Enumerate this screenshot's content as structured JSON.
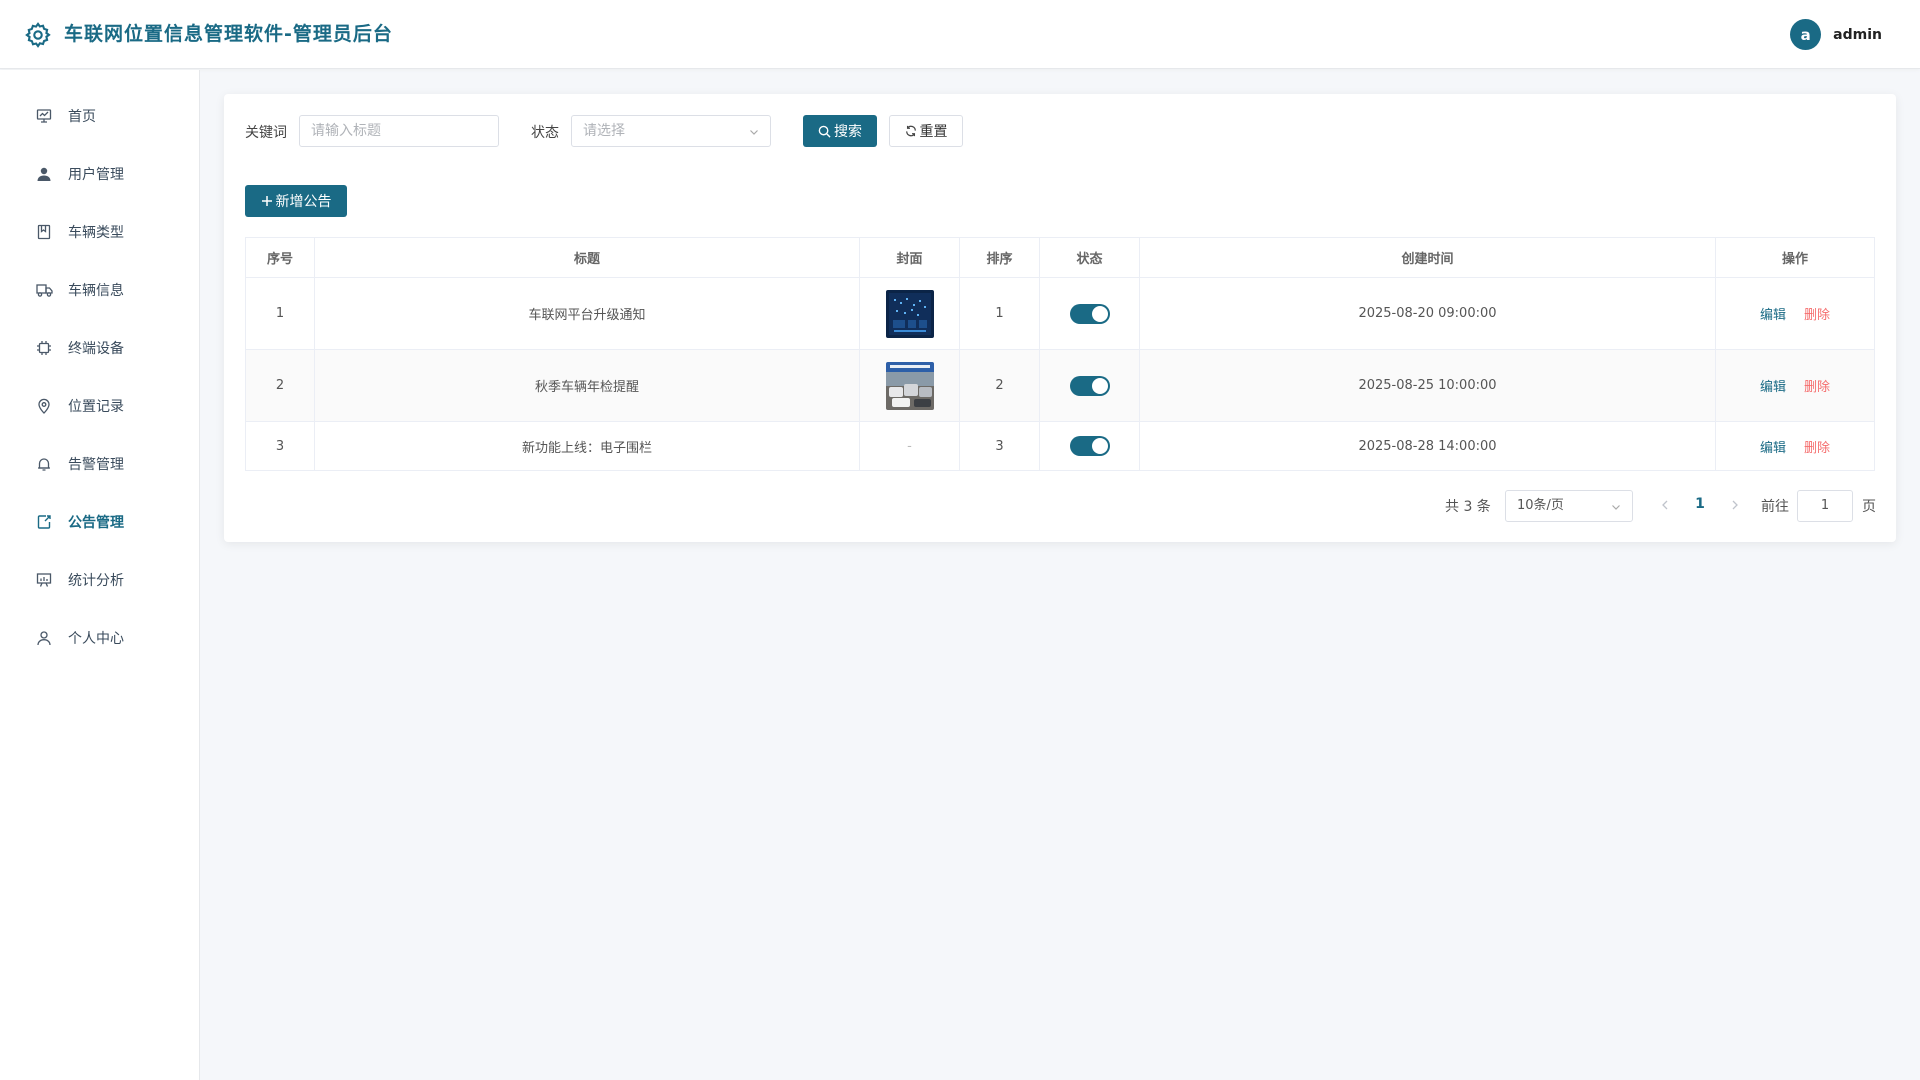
{
  "header": {
    "title": "车联网位置信息管理软件-管理员后台",
    "logo_icon": "gear-icon",
    "avatar_letter": "a",
    "username": "admin",
    "brand_color": "#1a6a85"
  },
  "sidebar": {
    "active_index": 7,
    "items": [
      {
        "label": "首页",
        "icon": "dashboard-icon"
      },
      {
        "label": "用户管理",
        "icon": "user-icon"
      },
      {
        "label": "车辆类型",
        "icon": "bookmark-icon"
      },
      {
        "label": "车辆信息",
        "icon": "truck-icon"
      },
      {
        "label": "终端设备",
        "icon": "chip-icon"
      },
      {
        "label": "位置记录",
        "icon": "location-pin-icon"
      },
      {
        "label": "告警管理",
        "icon": "bell-icon"
      },
      {
        "label": "公告管理",
        "icon": "notice-icon"
      },
      {
        "label": "统计分析",
        "icon": "chart-board-icon"
      },
      {
        "label": "个人中心",
        "icon": "person-outline-icon"
      }
    ]
  },
  "filters": {
    "keyword_label": "关键词",
    "keyword_placeholder": "请输入标题",
    "status_label": "状态",
    "status_placeholder": "请选择",
    "search_label": "搜索",
    "reset_label": "重置"
  },
  "actions": {
    "add_label": "新增公告"
  },
  "table": {
    "columns": [
      "序号",
      "标题",
      "封面",
      "排序",
      "状态",
      "创建时间",
      "操作"
    ],
    "rows": [
      {
        "index": "1",
        "title": "车联网平台升级通知",
        "cover": "dashboard-screen-image",
        "sort": "1",
        "status_on": true,
        "created": "2025-08-20 09:00:00",
        "edit": "编辑",
        "delete": "删除"
      },
      {
        "index": "2",
        "title": "秋季车辆年检提醒",
        "cover": "vehicle-inspection-station-image",
        "sort": "2",
        "status_on": true,
        "created": "2025-08-25 10:00:00",
        "edit": "编辑",
        "delete": "删除"
      },
      {
        "index": "3",
        "title": "新功能上线：电子围栏",
        "cover": "-",
        "sort": "3",
        "status_on": true,
        "created": "2025-08-28 14:00:00",
        "edit": "编辑",
        "delete": "删除"
      }
    ]
  },
  "pagination": {
    "total_text": "共 3 条",
    "page_size": "10条/页",
    "current_page": "1",
    "goto_label": "前往",
    "goto_value": "1",
    "page_suffix": "页"
  }
}
